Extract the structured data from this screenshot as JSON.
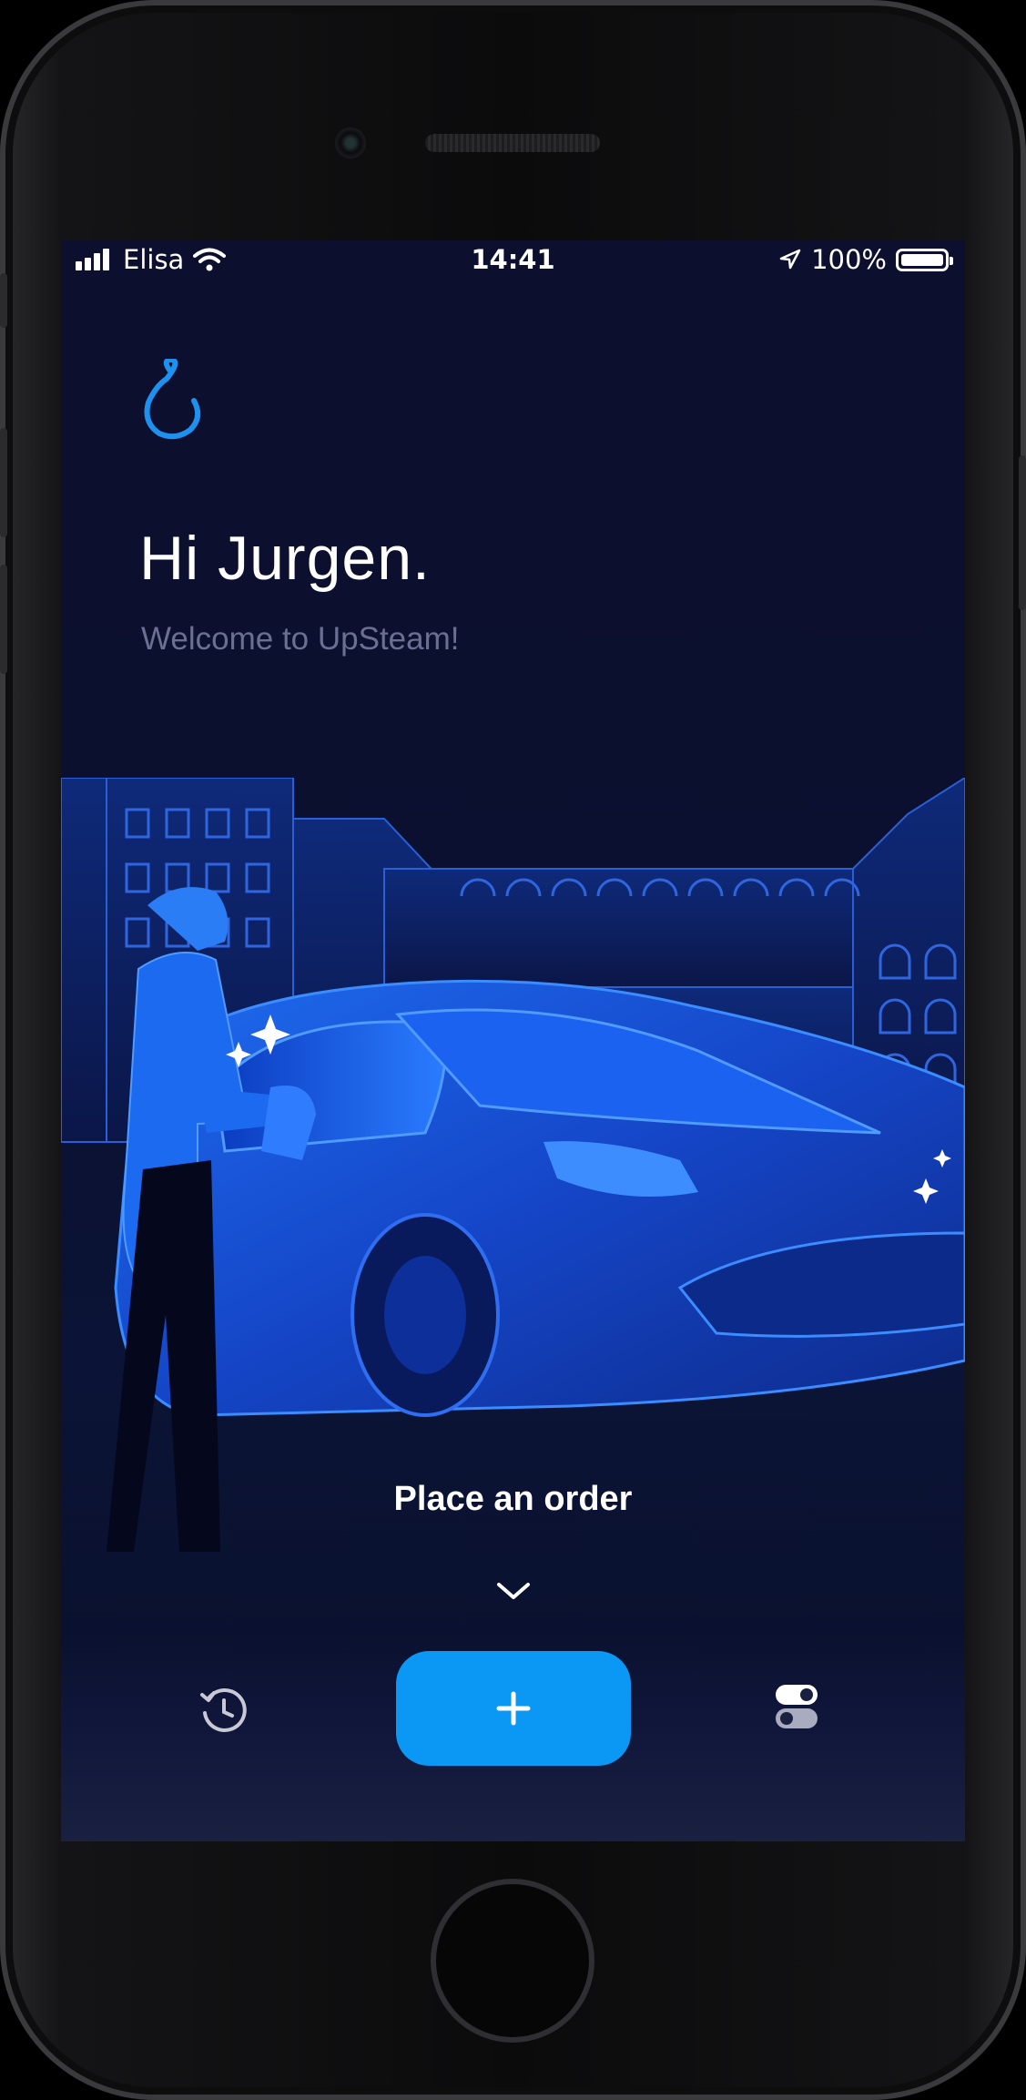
{
  "status_bar": {
    "carrier": "Elisa",
    "time": "14:41",
    "battery": "100%"
  },
  "header": {
    "greeting": "Hi Jurgen.",
    "welcome": "Welcome to UpSteam!"
  },
  "main": {
    "order_label": "Place an order",
    "add_button_label": "+"
  },
  "icons": {
    "logo": "upsteam-logo-icon",
    "history": "history-icon",
    "settings": "toggle-settings-icon",
    "chevron": "chevron-down-icon"
  },
  "colors": {
    "background": "#0c0f2d",
    "accent": "#0b97f4",
    "text": "#ffffff",
    "muted_text": "#6b6f92"
  }
}
